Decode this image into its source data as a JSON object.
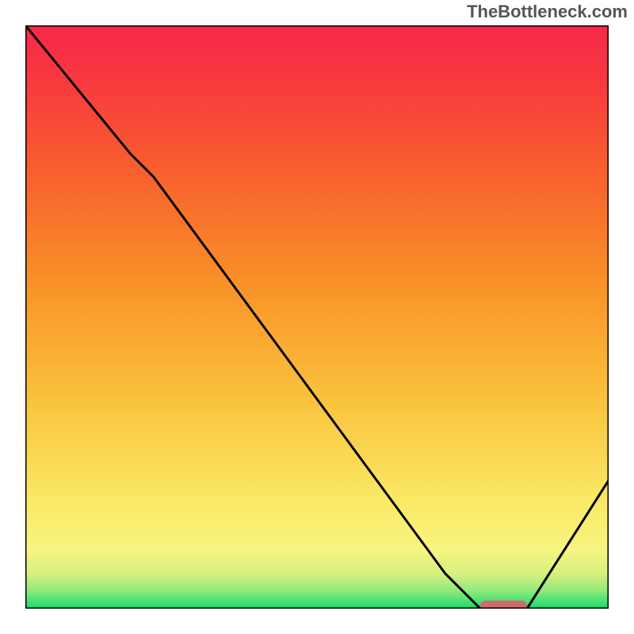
{
  "watermark": "TheBottleneck.com",
  "chart_data": {
    "type": "line",
    "title": "",
    "xlabel": "",
    "ylabel": "",
    "xlim": [
      0,
      100
    ],
    "ylim": [
      0,
      100
    ],
    "series": [
      {
        "name": "curve",
        "x": [
          0,
          18,
          22,
          72,
          78,
          86,
          100
        ],
        "values": [
          100,
          78,
          74,
          6,
          0,
          0,
          22
        ]
      }
    ],
    "marker": {
      "x_start": 78,
      "x_end": 86,
      "y": 0.5
    },
    "gradient_stops": [
      {
        "offset": 0.0,
        "color": "#14db6a"
      },
      {
        "offset": 0.03,
        "color": "#8ee97a"
      },
      {
        "offset": 0.06,
        "color": "#d8f07e"
      },
      {
        "offset": 0.1,
        "color": "#f7f481"
      },
      {
        "offset": 0.18,
        "color": "#fbea66"
      },
      {
        "offset": 0.35,
        "color": "#fac43e"
      },
      {
        "offset": 0.55,
        "color": "#f99427"
      },
      {
        "offset": 0.75,
        "color": "#f85f2e"
      },
      {
        "offset": 0.9,
        "color": "#f83a3e"
      },
      {
        "offset": 1.0,
        "color": "#f7284a"
      }
    ],
    "marker_color": "#cf6a6d",
    "line_color": "#000000",
    "frame_color": "#000000"
  }
}
